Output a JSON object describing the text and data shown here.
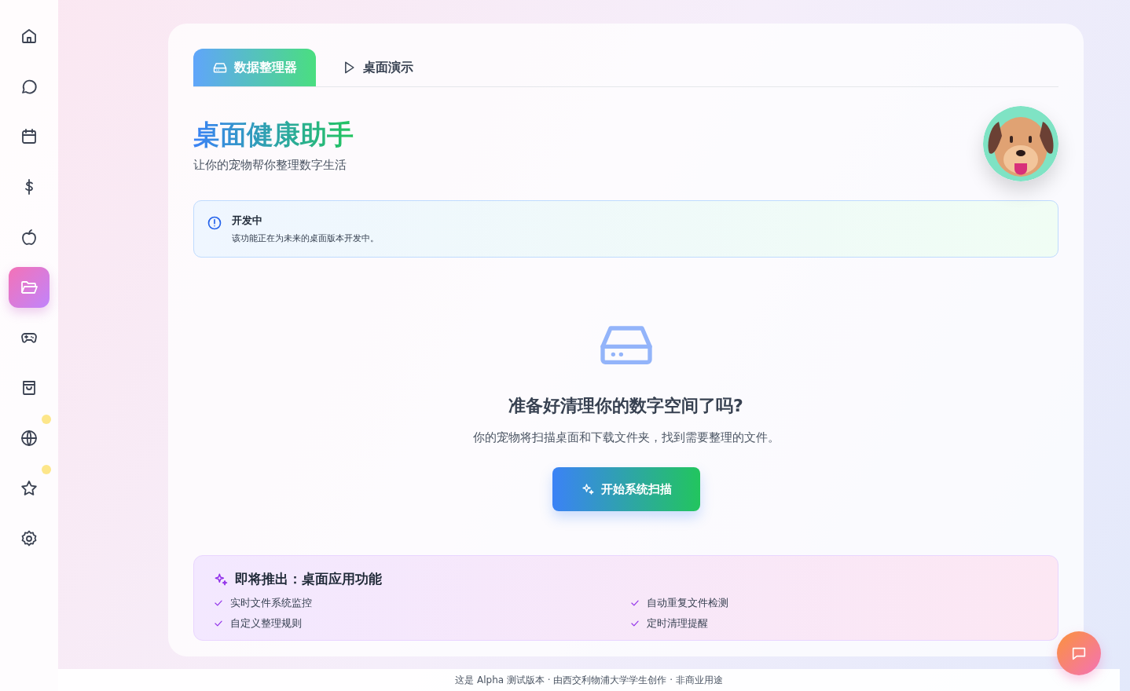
{
  "sidebar": {
    "items": [
      {
        "kind": "home",
        "selected": false,
        "dot": false
      },
      {
        "kind": "chat",
        "selected": false,
        "dot": false
      },
      {
        "kind": "calendar",
        "selected": false,
        "dot": false
      },
      {
        "kind": "dollar",
        "selected": false,
        "dot": false
      },
      {
        "kind": "apple",
        "selected": false,
        "dot": false
      },
      {
        "kind": "folder",
        "selected": true,
        "dot": false
      },
      {
        "kind": "gamepad",
        "selected": false,
        "dot": false
      },
      {
        "kind": "bag",
        "selected": false,
        "dot": false
      },
      {
        "kind": "globe",
        "selected": false,
        "dot": true
      },
      {
        "kind": "star",
        "selected": false,
        "dot": true
      },
      {
        "kind": "gear",
        "selected": false,
        "dot": false
      }
    ]
  },
  "tabs": [
    {
      "label": "数据整理器",
      "kind": "drive",
      "selected": true
    },
    {
      "label": "桌面演示",
      "kind": "play",
      "selected": false
    }
  ],
  "header": {
    "title": "桌面健康助手",
    "subtitle": "让你的宠物帮你整理数字生活"
  },
  "notice": {
    "title": "开发中",
    "text": "该功能正在为未来的桌面版本开发中。"
  },
  "empty_state": {
    "heading": "准备好清理你的数字空间了吗?",
    "text": "你的宠物将扫描桌面和下载文件夹，找到需要整理的文件。",
    "button": "开始系统扫描"
  },
  "upcoming": {
    "title": "即将推出：桌面应用功能",
    "features": [
      "实时文件系统监控",
      "自动重复文件检测",
      "自定义整理规则",
      "定时清理提醒"
    ]
  },
  "footer": "这是 Alpha 测试版本 · 由西交利物浦大学学生创作 · 非商业用途"
}
